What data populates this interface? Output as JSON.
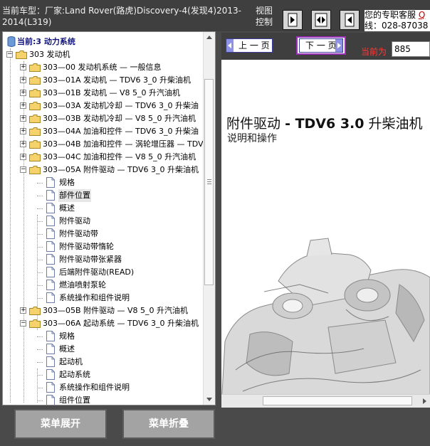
{
  "header": {
    "car_model": "当前车型：厂家:Land Rover(路虎)Discovery-4(发现4)2013-2014(L319)",
    "view_control": "视图控制",
    "service_line1": "您的专职客服",
    "service_link": "Q",
    "service_line2": "线：028-87038"
  },
  "tree": {
    "root": "当前:3 动力系统",
    "rows": [
      "303 发动机",
      "303—00 发动机系统 — 一般信息",
      "303—01A 发动机 — TDV6 3_0 升柴油机",
      "303—01B 发动机 — V8 5_0 升汽油机",
      "303—03A 发动机冷却 — TDV6 3_0 升柴油",
      "303—03B 发动机冷却 — V8 5_0 升汽油机",
      "303—04A 加油和控件 — TDV6 3_0 升柴油",
      "303—04B 加油和控件 — 涡轮增压器 — TDV",
      "303—04C 加油和控件 — V8 5_0 升汽油机",
      "303—05A 附件驱动 — TDV6 3_0 升柴油机",
      "规格",
      "部件位置",
      "概述",
      "附件驱动",
      "附件驱动带",
      "附件驱动带惰轮",
      "附件驱动带张紧器",
      "后端附件驱动(READ)",
      "燃油喷射泵轮",
      "系统操作和组件说明",
      "303—05B 附件驱动 — V8 5_0 升汽油机",
      "303—06A 起动系统 — TDV6 3_0 升柴油机",
      "规格",
      "概述",
      "起动机",
      "起动系统",
      "系统操作和组件说明",
      "组件位置"
    ]
  },
  "buttons": {
    "expand": "菜单展开",
    "collapse": "菜单折叠"
  },
  "doc": {
    "prev": "上 一 页",
    "next": "下 一 页",
    "current_label": "当前为",
    "current_page": "885",
    "title_cn": "附件驱动",
    "title_bold": "- TDV6 3.0",
    "title_tail": "升柴油机",
    "subtitle": "说明和操作"
  },
  "colors": {
    "background": "#4a4a4a",
    "header": "#3f3f3f",
    "root_label": "#10127e",
    "current_label": "#ff3a3a",
    "next_border": "#9a2fb8"
  }
}
